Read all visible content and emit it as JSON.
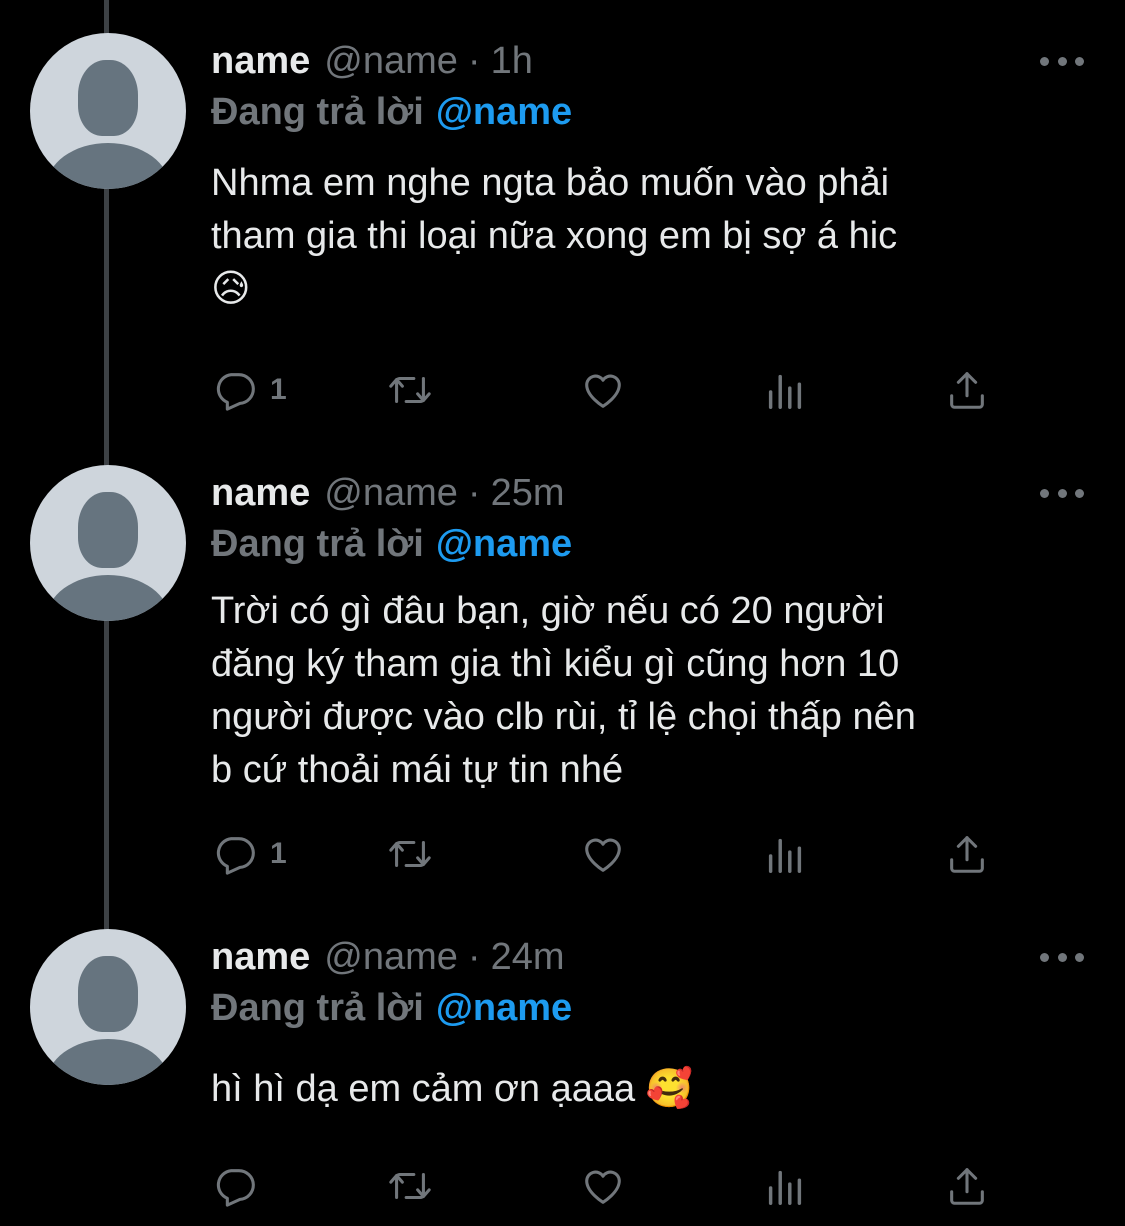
{
  "tweets": [
    {
      "display_name": "name",
      "handle": "@name",
      "dot": "·",
      "time": "1h",
      "reply_prefix": "Đang trả lời",
      "reply_mention": "@name",
      "text": "Nhma em nghe ngta bảo muốn vào phải\ntham gia thi loại nữa xong em bị sợ á hic\n😥",
      "reply_count": "1",
      "retweet_count": "",
      "like_count": ""
    },
    {
      "display_name": "name",
      "handle": "@name",
      "dot": "·",
      "time": "25m",
      "reply_prefix": "Đang trả lời",
      "reply_mention": "@name",
      "text": "Trời có gì đâu bạn, giờ nếu có 20 người\nđăng ký tham gia thì kiểu gì cũng hơn 10\nngười được vào clb rùi, tỉ lệ chọi thấp nên\nb cứ thoải mái tự tin nhé",
      "reply_count": "1",
      "retweet_count": "",
      "like_count": ""
    },
    {
      "display_name": "name",
      "handle": "@name",
      "dot": "·",
      "time": "24m",
      "reply_prefix": "Đang trả lời",
      "reply_mention": "@name",
      "text": "hì hì dạ em cảm ơn ạaaa 🥰",
      "reply_count": "",
      "retweet_count": "",
      "like_count": ""
    }
  ],
  "icons": {
    "reply": "reply-icon",
    "retweet": "retweet-icon",
    "like": "heart-icon",
    "views": "analytics-icon",
    "share": "share-icon",
    "more": "more-icon"
  },
  "colors": {
    "background": "#000000",
    "text": "#e7e9ea",
    "muted": "#71767b",
    "mention": "#1d9bf0",
    "thread_line": "#3d4145",
    "avatar_bg": "#ced5dc",
    "avatar_fg": "#66747f"
  }
}
